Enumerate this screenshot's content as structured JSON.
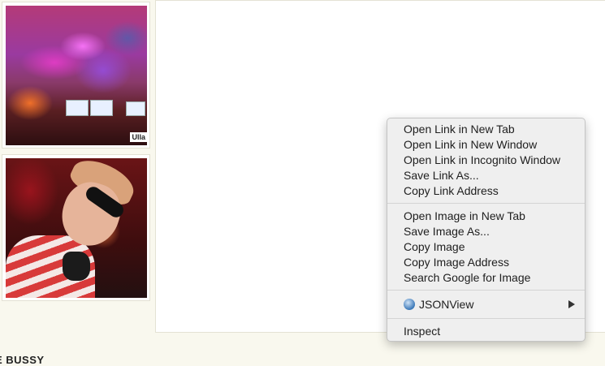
{
  "thumbnails": [
    {
      "watermark": "Ulla"
    },
    {}
  ],
  "section": {
    "heading": "E BUSSY"
  },
  "context_menu": {
    "link_group": [
      "Open Link in New Tab",
      "Open Link in New Window",
      "Open Link in Incognito Window",
      "Save Link As...",
      "Copy Link Address"
    ],
    "image_group": [
      "Open Image in New Tab",
      "Save Image As...",
      "Copy Image",
      "Copy Image Address",
      "Search Google for Image"
    ],
    "extension_item": {
      "label": "JSONView",
      "icon": "jsonview-icon",
      "submenu_icon": "chevron-right-icon"
    },
    "inspect_label": "Inspect"
  }
}
